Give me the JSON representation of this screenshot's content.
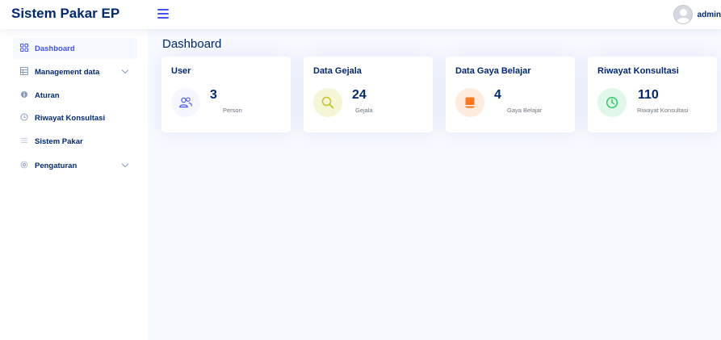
{
  "header": {
    "brand": "Sistem Pakar EP",
    "user_name": "admin"
  },
  "sidebar": {
    "items": [
      {
        "label": "Dashboard",
        "icon": "grid-icon",
        "active": true
      },
      {
        "label": "Management data",
        "icon": "table-icon",
        "has_submenu": true
      },
      {
        "label": "Aturan",
        "icon": "info-icon"
      },
      {
        "label": "Riwayat Konsultasi",
        "icon": "clock-icon"
      },
      {
        "label": "Sistem Pakar",
        "icon": "list-icon"
      },
      {
        "label": "Pengaturan",
        "icon": "gear-icon",
        "has_submenu": true
      }
    ]
  },
  "main": {
    "title": "Dashboard",
    "cards": [
      {
        "title": "User",
        "value": "3",
        "caption": "Person",
        "icon": "people-icon",
        "icon_color": "#4154f1",
        "icon_bg": "#f6f6fe"
      },
      {
        "title": "Data Gejala",
        "value": "24",
        "caption": "Gejala",
        "icon": "search-icon",
        "icon_color": "#c9c12c",
        "icon_bg": "#f4f6d5"
      },
      {
        "title": "Data Gaya Belajar",
        "value": "4",
        "caption": "Gaya Belajar",
        "icon": "book-icon",
        "icon_color": "#ff771d",
        "icon_bg": "#ffecdf"
      },
      {
        "title": "Riwayat Konsultasi",
        "value": "110",
        "caption": "Riwayat Konsultasi",
        "icon": "clock-icon",
        "icon_color": "#2eca6a",
        "icon_bg": "#e0f8e9"
      }
    ]
  },
  "colors": {
    "primary": "#4154f1",
    "navy": "#012970",
    "background": "#f6f9ff"
  }
}
